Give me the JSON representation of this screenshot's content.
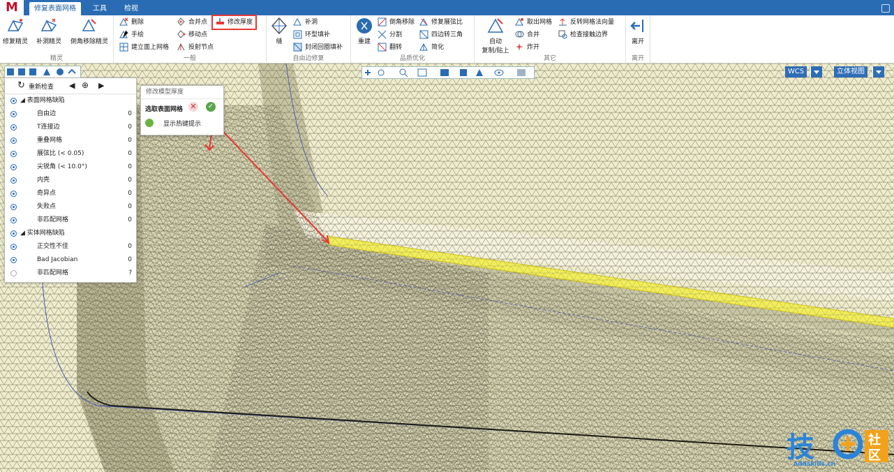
{
  "tabs": [
    "修复表面网格",
    "工具",
    "检视"
  ],
  "ribbon": {
    "groups": {
      "spirit": {
        "label": "精灵",
        "buttons": [
          "修复精灵",
          "补洞精灵",
          "倒角移除精灵"
        ]
      },
      "general": {
        "label": "一般",
        "col1": [
          "删除",
          "手绘",
          "建立面上网格"
        ],
        "col2": [
          "合并点",
          "移动点",
          "投射节点"
        ],
        "highlight": "修改厚度"
      },
      "freeedge": {
        "label": "自由边修复",
        "big": "缝",
        "items": [
          "补洞",
          "环型填补",
          "封闭回圈填补"
        ]
      },
      "quality": {
        "label": "品质优化",
        "big": "重建",
        "col1": [
          "倒角移除",
          "分割",
          "翻转"
        ],
        "col2": [
          "修复展弦比",
          "四边转三角",
          "简化"
        ]
      },
      "other": {
        "label": "其它",
        "big_line1": "自动",
        "big_line2": "复制/贴上",
        "col1": [
          "取出网格",
          "合并",
          "炸开"
        ],
        "col2": [
          "反转网格法向量",
          "检查接触边界"
        ]
      },
      "leave": {
        "label": "离开",
        "button": "离开"
      }
    }
  },
  "panel": {
    "recheck": "重新检查",
    "surface_section": "表面网格缺陷",
    "surface_items": [
      {
        "label": "自由边",
        "value": "0"
      },
      {
        "label": "T连接边",
        "value": "0"
      },
      {
        "label": "重叠网格",
        "value": "0"
      },
      {
        "label": "展弦比 (< 0.05)",
        "value": "0"
      },
      {
        "label": "尖锐角 (< 10.0°)",
        "value": "0"
      },
      {
        "label": "内壳",
        "value": "0"
      },
      {
        "label": "奇异点",
        "value": "0"
      },
      {
        "label": "失败点",
        "value": "0"
      },
      {
        "label": "非匹配网格",
        "value": "0"
      }
    ],
    "solid_section": "实体网格缺陷",
    "solid_items": [
      {
        "label": "正交性不佳",
        "value": "0"
      },
      {
        "label": "Bad Jacobian",
        "value": "0"
      },
      {
        "label": "非匹配网格",
        "value": "?"
      }
    ]
  },
  "popup": {
    "title": "修改模型厚度",
    "select_label": "选取表面网格",
    "hint": "显示热键提示"
  },
  "view": {
    "coord": "WCS",
    "view_mode": "立体视图"
  },
  "watermark": {
    "main": "技",
    "side1": "社",
    "side2": "区",
    "url": "addskills.cn"
  },
  "colors": {
    "accent": "#2a6cb3",
    "highlight": "#e53935",
    "mesh": "#efeccd",
    "selected": "#f2ee5a"
  }
}
